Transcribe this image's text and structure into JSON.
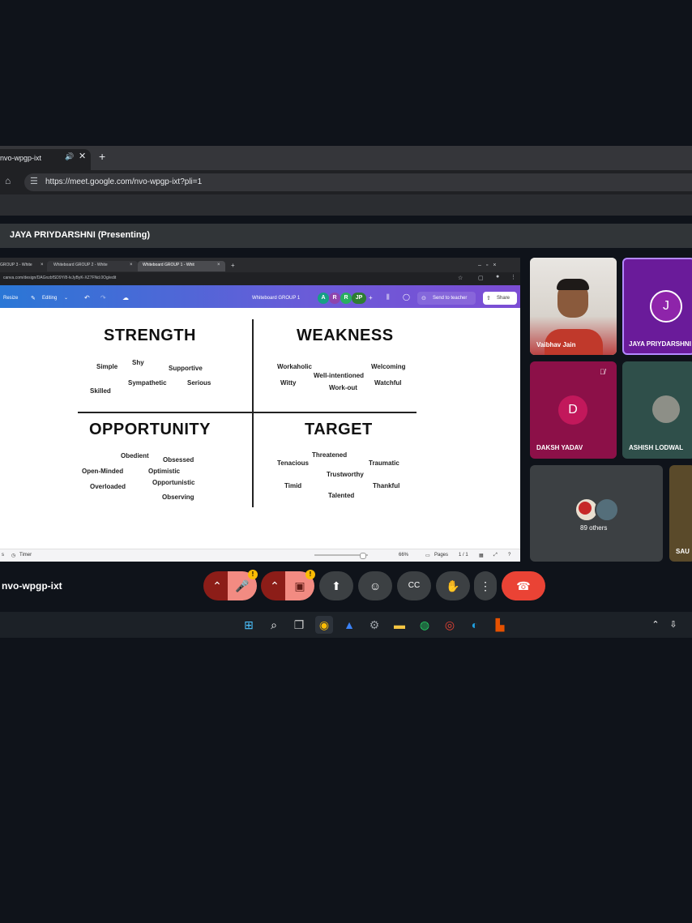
{
  "browser": {
    "tab_title": "nvo-wpgp-ixt",
    "tab_audio_icon": "speaker-icon",
    "tab_close": "✕",
    "new_tab": "+",
    "url": "https://meet.google.com/nvo-wpgp-ixt?pli=1"
  },
  "meet": {
    "presenter_label": "JAYA PRIYDARSHNI (Presenting)",
    "meeting_code": "nvo-wpgp-ixt",
    "tiles": [
      {
        "name": "Vaibhav Jain",
        "type": "video"
      },
      {
        "name": "JAYA PRIYDARSHNI",
        "initial": "J",
        "color": "#7b1fa2"
      },
      {
        "name": "DAKSH YADAV",
        "initial": "D",
        "color": "#b0155f"
      },
      {
        "name": "ASHISH LODWAL",
        "type": "avatar"
      },
      {
        "name": "89 others"
      },
      {
        "name": "SAU"
      }
    ]
  },
  "shared_screen": {
    "inner_tabs": [
      "GROUP 3 - White",
      "Whiteboard GROUP 2 - White",
      "Whiteboard GROUP 1 - Whit"
    ],
    "inner_url": "canva.com/design/DAGnzbfSD9Y/8-lvJyByK-XZ7FNd.0Og/edit",
    "canva_resize": "Resize",
    "canva_editing": "Editing",
    "doc_title": "Whiteboard GROUP 1",
    "avatars": [
      {
        "label": "A",
        "color": "#16a085"
      },
      {
        "label": "R",
        "color": "#8e44ad"
      },
      {
        "label": "R",
        "color": "#27ae60"
      },
      {
        "label": "JP",
        "color": "#2e7d32"
      }
    ],
    "send_to_teacher": "Send to teacher",
    "share": "Share",
    "timer": "Timer",
    "zoom": "66%",
    "pages_label": "Pages",
    "page_count": "1 / 1"
  },
  "board": {
    "strength": {
      "heading": "STRENGTH",
      "words": [
        "Shy",
        "Simple",
        "Supportive",
        "Sympathetic",
        "Serious",
        "Skilled"
      ]
    },
    "weakness": {
      "heading": "WEAKNESS",
      "words": [
        "Workaholic",
        "Welcoming",
        "Well-intentioned",
        "Witty",
        "Watchful",
        "Work-out"
      ]
    },
    "opportunity": {
      "heading": "OPPORTUNITY",
      "words": [
        "Obedient",
        "Obsessed",
        "Open-Minded",
        "Optimistic",
        "Opportunistic",
        "Overloaded",
        "Observing"
      ]
    },
    "target": {
      "heading": "TARGET",
      "words": [
        "Threatened",
        "Tenacious",
        "Traumatic",
        "Trustworthy",
        "Timid",
        "Thankful",
        "Talented"
      ]
    }
  },
  "colors": {
    "end_call": "#ea4335",
    "mic_off": "#f28b82",
    "purple_tile": "#7b1fa2",
    "pink_tile": "#b0155f"
  }
}
